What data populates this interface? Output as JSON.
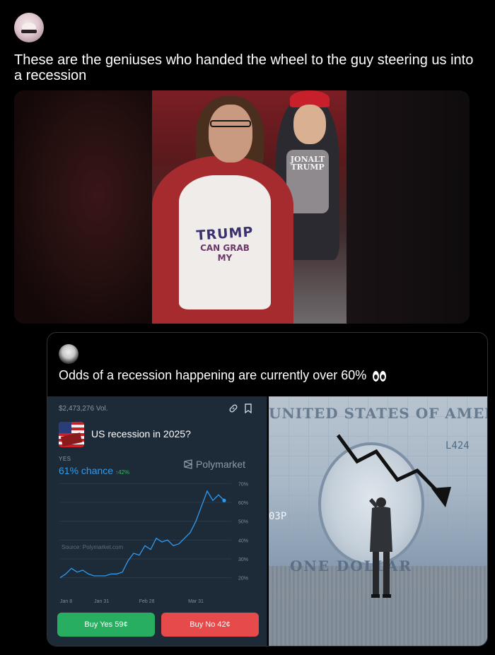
{
  "post": {
    "text": "These are the geniuses who handed the wheel to the guy steering us into a recession",
    "photo_shirt_text": [
      "TRUMP",
      "CAN GRAB",
      "MY"
    ],
    "photo_shirt2_text": [
      "JONALT",
      "TRUMP"
    ]
  },
  "quoted": {
    "text": "Odds of a recession happening are currently over 60%",
    "emoji": "eyes-icon"
  },
  "polymarket": {
    "volume": "$2,473,276 Vol.",
    "question": "US recession in 2025?",
    "yes_label": "YES",
    "chance": "61% chance",
    "delta": "↑42%",
    "brand": "Polymarket",
    "source": "Source: Polymarket.com",
    "buy_yes": "Buy Yes 59¢",
    "buy_no": "Buy No 42¢"
  },
  "chart_data": {
    "type": "line",
    "y_ticks": [
      "70%",
      "60%",
      "50%",
      "40%",
      "30%",
      "20%"
    ],
    "x_ticks": [
      "Jan 8",
      "Jan 31",
      "Feb 28",
      "Mar 31"
    ],
    "ylim": [
      15,
      72
    ],
    "grid": true,
    "series": [
      {
        "color": "#2e9bf0",
        "x": [
          0,
          3,
          6,
          9,
          12,
          15,
          18,
          21,
          24,
          27,
          30,
          33,
          36,
          39,
          42,
          45,
          48,
          51,
          54,
          57,
          60,
          63,
          66,
          69,
          72,
          75,
          78,
          81,
          84,
          87
        ],
        "values": [
          20,
          22,
          25,
          23,
          24,
          22,
          21,
          21,
          21,
          22,
          22,
          23,
          29,
          33,
          32,
          37,
          35,
          41,
          39,
          40,
          37,
          38,
          41,
          44,
          50,
          58,
          66,
          61,
          64,
          61
        ]
      }
    ]
  },
  "dollar_image": {
    "banner": "UNITED STATES OF AMERICA",
    "serial": "L424",
    "serial2": "03P",
    "denomination": "ONE DOLLAR"
  }
}
